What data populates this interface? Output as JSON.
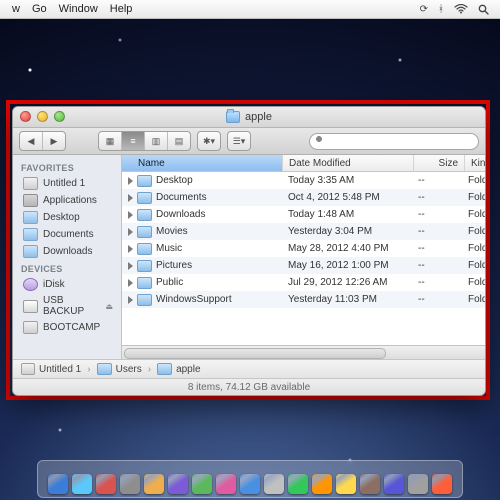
{
  "menubar": {
    "items": [
      "w",
      "Go",
      "Window",
      "Help"
    ]
  },
  "window": {
    "title": "apple",
    "search_placeholder": ""
  },
  "sidebar": {
    "sections": [
      {
        "header": "FAVORITES",
        "items": [
          {
            "label": "Untitled 1",
            "icon": "hd"
          },
          {
            "label": "Applications",
            "icon": "app"
          },
          {
            "label": "Desktop",
            "icon": "folder"
          },
          {
            "label": "Documents",
            "icon": "folder"
          },
          {
            "label": "Downloads",
            "icon": "folder"
          }
        ]
      },
      {
        "header": "DEVICES",
        "items": [
          {
            "label": "iDisk",
            "icon": "idisk"
          },
          {
            "label": "USB BACKUP",
            "icon": "usb",
            "eject": true
          },
          {
            "label": "BOOTCAMP",
            "icon": "hd"
          }
        ]
      }
    ]
  },
  "columns": {
    "name": "Name",
    "date": "Date Modified",
    "size": "Size",
    "kind": "Kind"
  },
  "rows": [
    {
      "name": "Desktop",
      "date": "Today 3:35 AM",
      "size": "--",
      "kind": "Folde"
    },
    {
      "name": "Documents",
      "date": "Oct 4, 2012 5:48 PM",
      "size": "--",
      "kind": "Folde"
    },
    {
      "name": "Downloads",
      "date": "Today 1:48 AM",
      "size": "--",
      "kind": "Folde"
    },
    {
      "name": "Movies",
      "date": "Yesterday 3:04 PM",
      "size": "--",
      "kind": "Folde"
    },
    {
      "name": "Music",
      "date": "May 28, 2012 4:40 PM",
      "size": "--",
      "kind": "Folde"
    },
    {
      "name": "Pictures",
      "date": "May 16, 2012 1:00 PM",
      "size": "--",
      "kind": "Folde"
    },
    {
      "name": "Public",
      "date": "Jul 29, 2012 12:26 AM",
      "size": "--",
      "kind": "Folde"
    },
    {
      "name": "WindowsSupport",
      "date": "Yesterday 11:03 PM",
      "size": "--",
      "kind": "Folde"
    }
  ],
  "path": {
    "crumbs": [
      "Untitled 1",
      "Users",
      "apple"
    ]
  },
  "status": "8 items, 74.12 GB available",
  "dock_colors": [
    "#3b7dd8",
    "#5ac8fa",
    "#d9534f",
    "#8e8e8e",
    "#f0ad4e",
    "#7b5bd6",
    "#5cb85c",
    "#e05ca0",
    "#4a90e2",
    "#c0c0c0",
    "#34c759",
    "#ff9500",
    "#ffd84d",
    "#8d6e63",
    "#5856d6",
    "#a0a0a0",
    "#ff5e3a"
  ]
}
